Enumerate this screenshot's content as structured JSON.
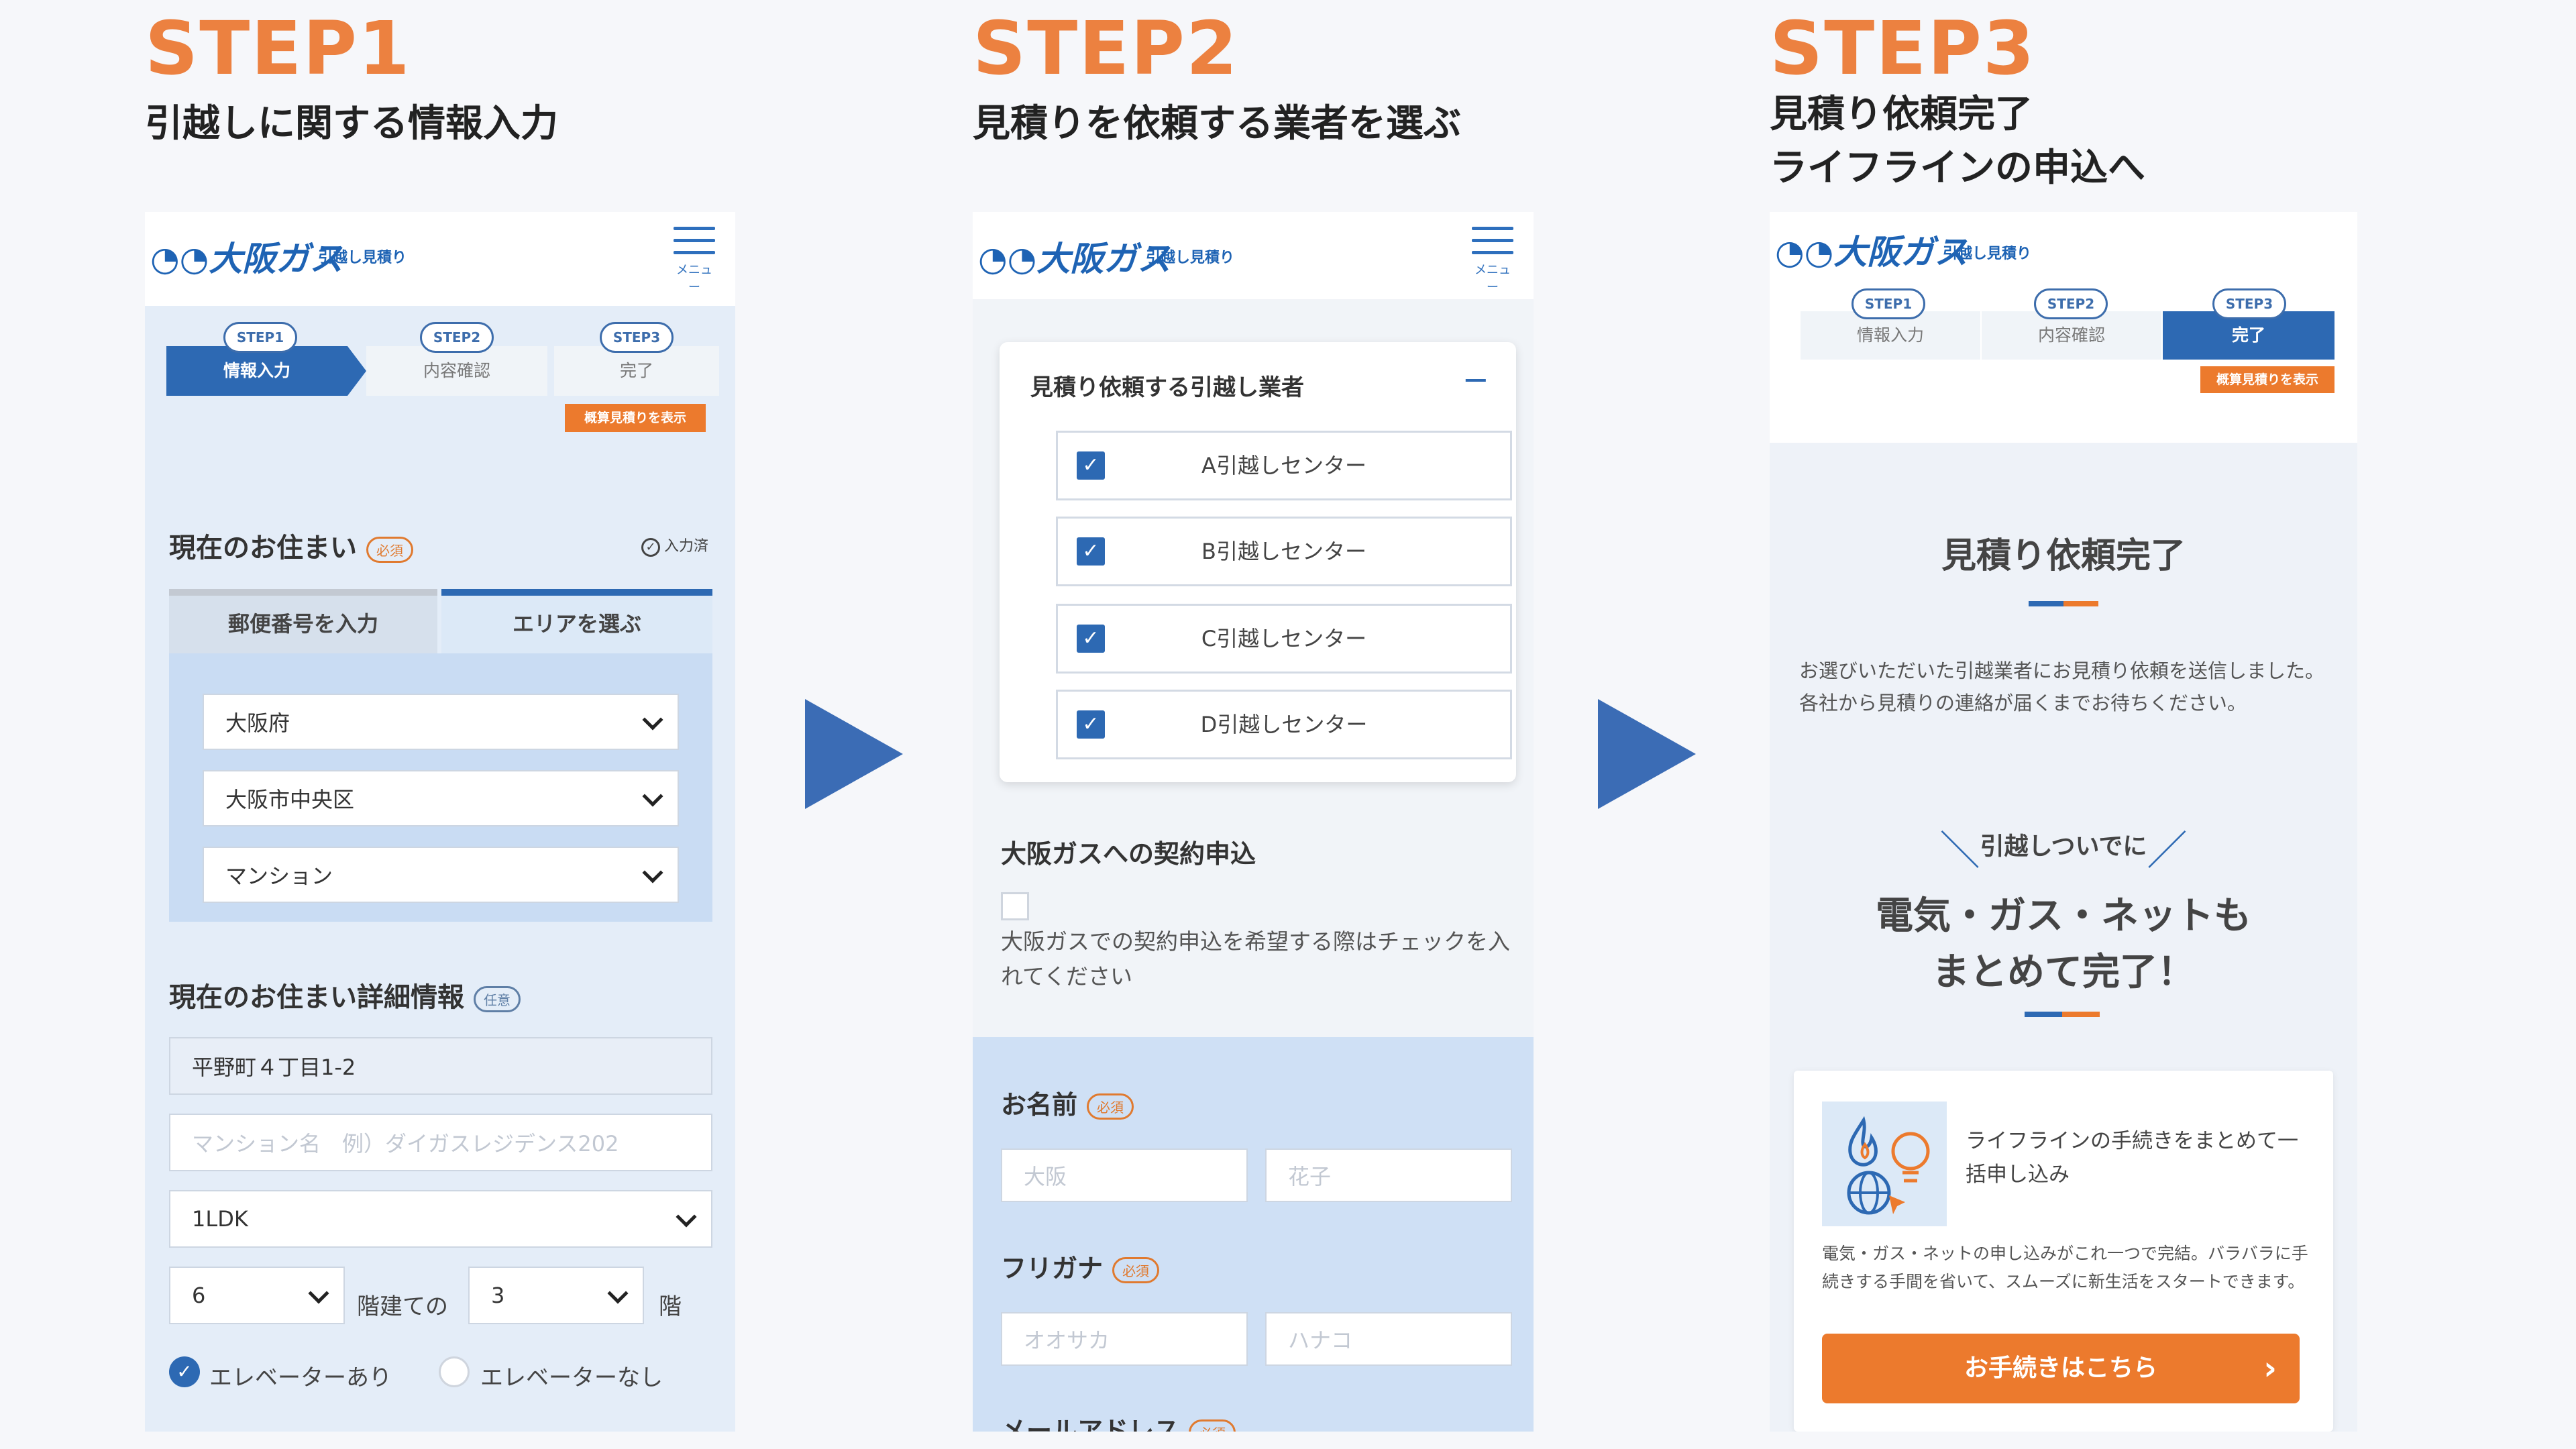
{
  "steps": [
    {
      "title": "STEP1",
      "subtitle": "引越しに関する情報入力"
    },
    {
      "title": "STEP2",
      "subtitle": "見積りを依頼する業者を選ぶ"
    },
    {
      "title": "STEP3",
      "subtitle_lines": [
        "見積り依頼完了",
        "ライフラインの申込へ"
      ]
    }
  ],
  "header": {
    "logo": "大阪ガス",
    "logo_sub": "引越し見積り",
    "menu_label": "メニュー"
  },
  "progress": {
    "steps": [
      {
        "tag": "STEP1",
        "label": "情報入力"
      },
      {
        "tag": "STEP2",
        "label": "内容確認"
      },
      {
        "tag": "STEP3",
        "label": "完了"
      }
    ],
    "badge": "概算見積りを表示"
  },
  "screen1": {
    "current_home": {
      "title": "現在のお住まい",
      "required": "必須",
      "entry_toggle": "入力済",
      "tabs": [
        "郵便番号を入力",
        "エリアを選ぶ"
      ],
      "prefecture": "大阪府",
      "city": "大阪市中央区",
      "building_type": "マンション"
    },
    "details": {
      "title": "現在のお住まい詳細情報",
      "optional": "任意",
      "address": "平野町４丁目1-2",
      "building_name_placeholder": "マンション名　例）ダイガスレジデンス202",
      "layout": "1LDK",
      "floors_total": "6",
      "floors_total_suffix": "階建ての",
      "floor": "3",
      "floor_suffix": "階",
      "elevator_yes": "エレベーターあり",
      "elevator_no": "エレベーターなし"
    }
  },
  "screen2": {
    "vendor_panel_title": "見積り依頼する引越し業者",
    "collapse_icon": "−",
    "vendors": [
      "A引越しセンター",
      "B引越しセンター",
      "C引越しセンター",
      "D引越しセンター"
    ],
    "contract_title": "大阪ガスへの契約申込",
    "contract_text": "大阪ガスでの契約申込を希望する際はチェックを入れてください",
    "name_label": "お名前",
    "required": "必須",
    "last_name_placeholder": "大阪",
    "first_name_placeholder": "花子",
    "kana_label": "フリガナ",
    "last_kana_placeholder": "オオサカ",
    "first_kana_placeholder": "ハナコ",
    "email_label": "メールアドレス"
  },
  "screen3": {
    "done_title": "見積り依頼完了",
    "done_text": "お選びいただいた引越業者にお見積り依頼を送信しました。各社から見積りの連絡が届くまでお待ちください。",
    "promo_kicker": "引越しついでに",
    "promo_headline_lines": [
      "電気・ガス・ネットも",
      "まとめて完了！"
    ],
    "card_title": "ライフラインの手続きをまとめて一括申し込み",
    "card_text": "電気・ガス・ネットの申し込みがこれ一つで完結。バラバラに手続きする手間を省いて、スムーズに新生活をスタートできます。",
    "cta_label": "お手続きはこちら",
    "cta_arrow": "›"
  },
  "colors": {
    "accent_orange": "#ec8140",
    "brand_blue": "#2d69b3",
    "light_blue": "#dce9f7"
  }
}
